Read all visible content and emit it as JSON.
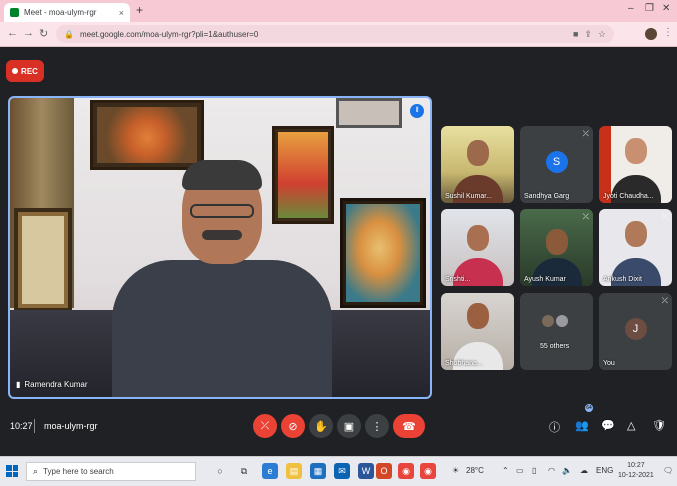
{
  "browser": {
    "tab_title": "Meet - moa-ulym-rgr",
    "url": "meet.google.com/moa-ulym-rgr?pli=1&authuser=0",
    "new_tab": "+",
    "close_tab": "×"
  },
  "recording": {
    "label": "REC"
  },
  "main_speaker": {
    "name": "Ramendra Kumar"
  },
  "participants": [
    {
      "name": "Sushil Kumar...",
      "type": "video"
    },
    {
      "name": "Sandhya Garg",
      "type": "avatar",
      "initial": "S",
      "color": "#1a73e8"
    },
    {
      "name": "Jyoti Chaudha...",
      "type": "video"
    },
    {
      "name": "Srishti...",
      "type": "video"
    },
    {
      "name": "Ayush Kumar",
      "type": "video"
    },
    {
      "name": "Ankush Dixit",
      "type": "video"
    },
    {
      "name": "Shobhana...",
      "type": "video"
    },
    {
      "name": "55 others",
      "type": "others"
    },
    {
      "name": "You",
      "type": "avatar",
      "initial": "J",
      "color": "#6d4c41"
    }
  ],
  "bottom_bar": {
    "time": "10:27",
    "meeting_code": "moa-ulym-rgr",
    "participant_count": "64"
  },
  "taskbar": {
    "search_placeholder": "Type here to search",
    "weather": "28°C",
    "lang": "ENG",
    "time": "10:27",
    "date": "10-12-2021"
  }
}
